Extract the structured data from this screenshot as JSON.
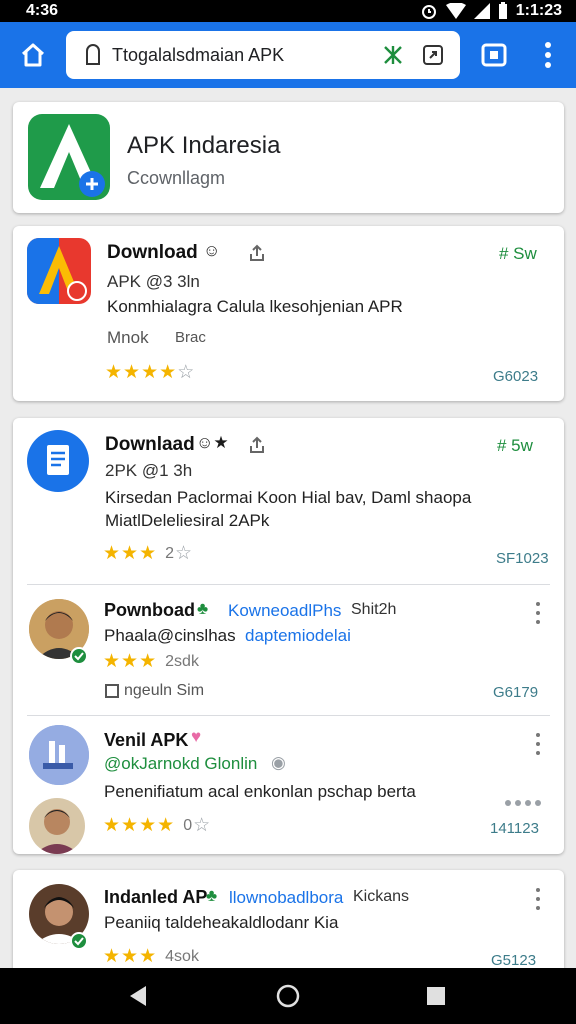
{
  "status": {
    "time": "4:36",
    "clock": "1:1:23"
  },
  "browser": {
    "url": "Ttogalalsdmaian APK"
  },
  "site": {
    "title": "APK Indaresia",
    "subtitle": "Ccownllagm"
  },
  "card1": {
    "title": "Download",
    "meta": "APK @3 3ln",
    "desc": "Konmhialagra Calula lkesohjenian APR",
    "tag1": "Mnok",
    "tag2": "Brac",
    "side": "# Sw",
    "code": "G6023"
  },
  "card2": {
    "title": "Downlaad",
    "meta": "2PK @1 3h",
    "desc1": "Kirsedan Paclormai Koon Hial bav, Daml shaopa",
    "desc2": "MiatlDeleliesiral 2APk",
    "rating_after": "2",
    "side": "# 5w",
    "code": "SF1023"
  },
  "item1": {
    "title": "Pownboad",
    "link1": "KowneoadlPhs",
    "link2": "Shit2h",
    "handle": "Phaala@cinslhas",
    "handle_link": "daptemiodelai",
    "rating_after": "2sdk",
    "note": "ngeuln Sim",
    "code": "G6179"
  },
  "item2": {
    "title": "Venil APK",
    "handle": "@okJarnokd Glonlin",
    "desc": "Penenifiatum acal enkonlan pschap berta",
    "rating_after": "0",
    "code": "141123"
  },
  "item3": {
    "title": "Indanled AP",
    "link": "llownobadlbora",
    "link2": "Kickans",
    "desc": "Peaniiq taldeheakaldlodanr Kia",
    "rating_after": "4sok",
    "code": "G5123"
  },
  "icons": [
    "home-icon",
    "lock-icon",
    "download-icon",
    "share-icon",
    "tabs-icon",
    "menu-icon",
    "back-icon",
    "home-circle-icon",
    "recents-icon"
  ],
  "colors": {
    "accent": "#1a73e8",
    "star": "#f4b400",
    "green": "#1e8e3e"
  }
}
